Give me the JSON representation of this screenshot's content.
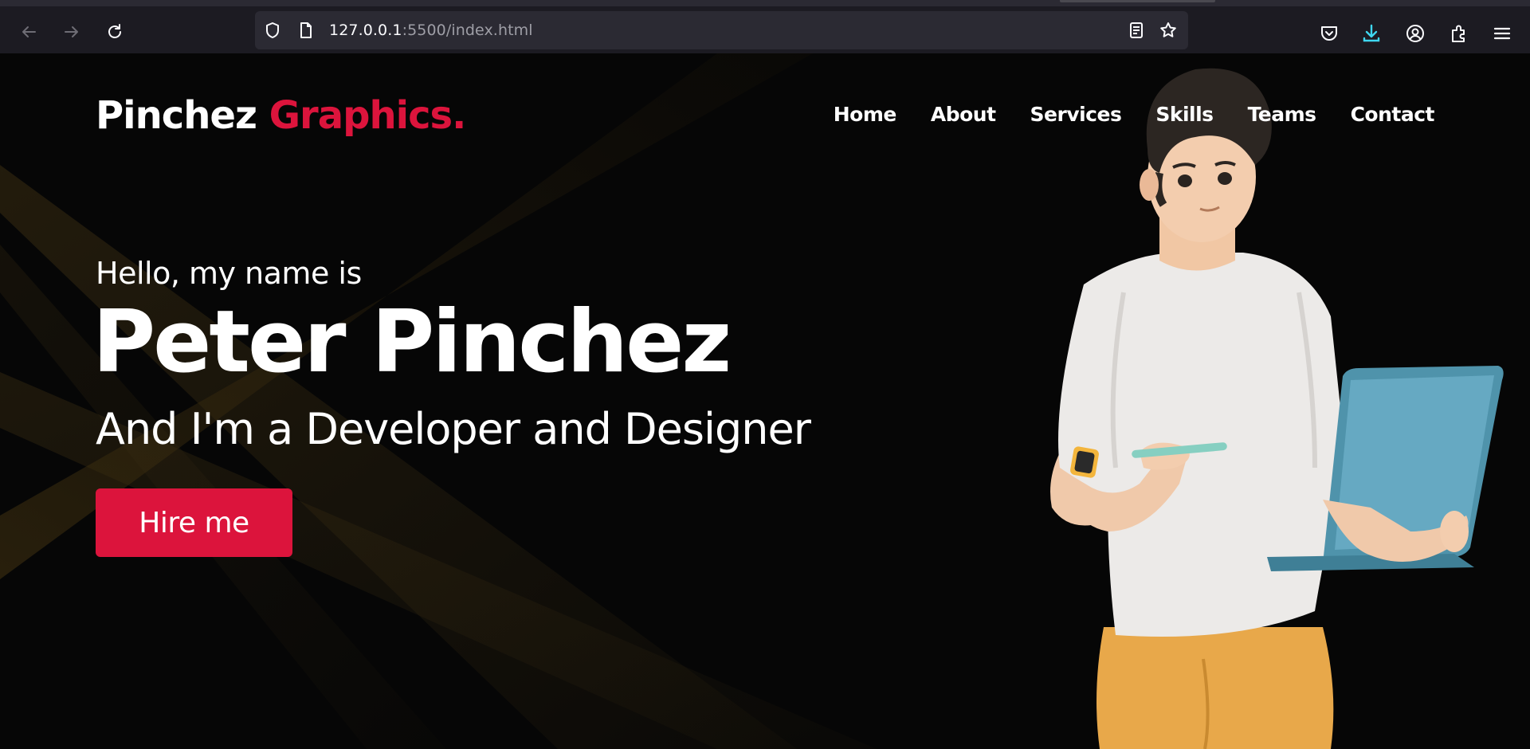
{
  "browser": {
    "url_host": "127.0.0.1",
    "url_path": ":5500/index.html",
    "icons": {
      "back": "back-arrow-icon",
      "forward": "forward-arrow-icon",
      "reload": "reload-icon",
      "shield": "shield-icon",
      "page": "page-icon",
      "reader": "reader-view-icon",
      "bookmark": "star-icon",
      "pocket": "pocket-icon",
      "downloads": "download-icon",
      "account": "account-icon",
      "extensions": "extensions-icon",
      "menu": "hamburger-menu-icon"
    }
  },
  "site": {
    "logo_main": "Pinchez ",
    "logo_accent": "Graphics.",
    "nav": [
      "Home",
      "About",
      "Services",
      "Skills",
      "Teams",
      "Contact"
    ],
    "hero": {
      "greeting": "Hello, my name is",
      "name": "Peter Pinchez",
      "role": "And I'm a Developer and Designer",
      "cta": "Hire me"
    }
  },
  "colors": {
    "accent": "#dc143c",
    "background": "#060606",
    "text": "#ffffff",
    "download_icon": "#3fd7f0"
  }
}
